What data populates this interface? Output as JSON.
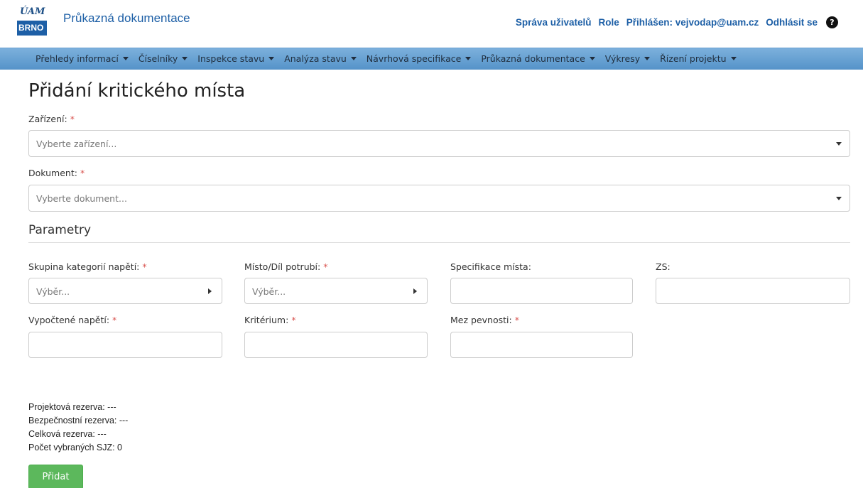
{
  "header": {
    "logo_top": "ÚAM",
    "logo_bottom": "BRNO",
    "app_title": "Průkazná dokumentace",
    "links": {
      "user_admin": "Správa uživatelů",
      "role": "Role",
      "logged_in": "Přihlášen: vejvodap@uam.cz",
      "logout": "Odhlásit se"
    },
    "help_icon": "?"
  },
  "nav": {
    "items": [
      "Přehledy informací",
      "Číselníky",
      "Inspekce stavu",
      "Analýza stavu",
      "Návrhová specifikace",
      "Průkazná dokumentace",
      "Výkresy",
      "Řízení projektu"
    ]
  },
  "page": {
    "title": "Přidání kritického místa",
    "device": {
      "label": "Zařízení:",
      "required": "*",
      "placeholder": "Vyberte zařízení..."
    },
    "document": {
      "label": "Dokument:",
      "required": "*",
      "placeholder": "Vyberte dokument..."
    },
    "params_title": "Parametry",
    "params": {
      "stress_group": {
        "label": "Skupina kategorií napětí:",
        "required": "*",
        "placeholder": "Výběr..."
      },
      "place": {
        "label": "Místo/Díl potrubí:",
        "required": "*",
        "placeholder": "Výběr..."
      },
      "place_spec": {
        "label": "Specifikace místa:",
        "value": ""
      },
      "zs": {
        "label": "ZS:",
        "value": ""
      },
      "computed_stress": {
        "label": "Vypočtené napětí:",
        "required": "*",
        "value": ""
      },
      "criterion": {
        "label": "Kritérium:",
        "required": "*",
        "value": ""
      },
      "strength_limit": {
        "label": "Mez pevnosti:",
        "required": "*",
        "value": ""
      }
    },
    "info": {
      "project_reserve": "Projektová rezerva: ---",
      "safety_reserve": "Bezpečnostní rezerva: ---",
      "total_reserve": "Celková rezerva: ---",
      "selected_count": "Počet vybraných SJZ: 0"
    },
    "add_button": "Přidat"
  },
  "colors": {
    "brand_blue": "#1d5fa6",
    "nav_bg": "#6aa1d2",
    "required": "#d9534f",
    "success": "#5cb85c"
  }
}
